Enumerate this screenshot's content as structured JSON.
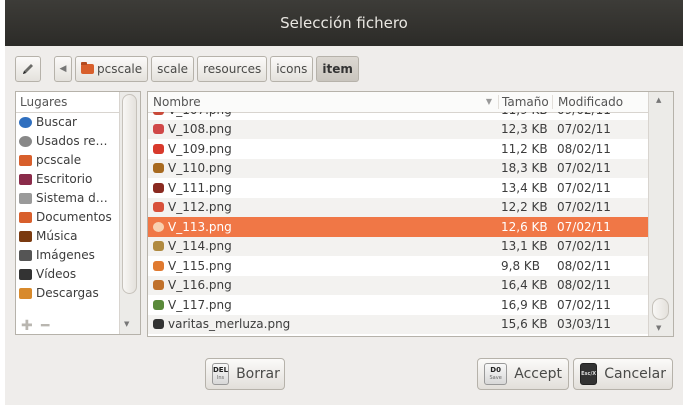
{
  "window": {
    "title": "Selección fichero"
  },
  "pathbar": {
    "items": [
      {
        "label": "pcscale"
      },
      {
        "label": "scale"
      },
      {
        "label": "resources"
      },
      {
        "label": "icons"
      },
      {
        "label": "item"
      }
    ]
  },
  "places": {
    "header": "Lugares",
    "items": [
      {
        "label": "Buscar",
        "icon": "search-icon",
        "color": "#2f6fbf"
      },
      {
        "label": "Usados re…",
        "icon": "clock-icon",
        "color": "#888888"
      },
      {
        "label": "pcscale",
        "icon": "home-folder-icon",
        "color": "#d85f2c"
      },
      {
        "label": "Escritorio",
        "icon": "desktop-icon",
        "color": "#8a2b4a"
      },
      {
        "label": "Sistema d…",
        "icon": "drive-icon",
        "color": "#9a9a9a"
      },
      {
        "label": "Documentos",
        "icon": "documents-icon",
        "color": "#d85f2c"
      },
      {
        "label": "Música",
        "icon": "music-icon",
        "color": "#7a3a10"
      },
      {
        "label": "Imágenes",
        "icon": "pictures-icon",
        "color": "#555555"
      },
      {
        "label": "Vídeos",
        "icon": "videos-icon",
        "color": "#333333"
      },
      {
        "label": "Descargas",
        "icon": "downloads-icon",
        "color": "#d88a2c"
      }
    ]
  },
  "files": {
    "columns": {
      "name": "Nombre",
      "size": "Tamaño",
      "modified": "Modificado"
    },
    "rows": [
      {
        "name": "V_107.png",
        "size": "11,9 KB",
        "modified": "09/02/11",
        "color": "#c94a3a"
      },
      {
        "name": "V_108.png",
        "size": "12,3 KB",
        "modified": "07/02/11",
        "color": "#d04848"
      },
      {
        "name": "V_109.png",
        "size": "11,2 KB",
        "modified": "08/02/11",
        "color": "#d83a2c"
      },
      {
        "name": "V_110.png",
        "size": "18,3 KB",
        "modified": "07/02/11",
        "color": "#a86a20"
      },
      {
        "name": "V_111.png",
        "size": "13,4 KB",
        "modified": "07/02/11",
        "color": "#8a2a20"
      },
      {
        "name": "V_112.png",
        "size": "12,2 KB",
        "modified": "07/02/11",
        "color": "#d8503a"
      },
      {
        "name": "V_113.png",
        "size": "12,6 KB",
        "modified": "07/02/11",
        "color": "#f8d0b0",
        "selected": true
      },
      {
        "name": "V_114.png",
        "size": "13,1 KB",
        "modified": "07/02/11",
        "color": "#b08a40"
      },
      {
        "name": "V_115.png",
        "size": "9,8 KB",
        "modified": "08/02/11",
        "color": "#e07a30"
      },
      {
        "name": "V_116.png",
        "size": "16,4 KB",
        "modified": "08/02/11",
        "color": "#c0702a"
      },
      {
        "name": "V_117.png",
        "size": "16,9 KB",
        "modified": "07/02/11",
        "color": "#5a8a3a"
      },
      {
        "name": "varitas_merluza.png",
        "size": "15,6 KB",
        "modified": "03/03/11",
        "color": "#333333"
      }
    ]
  },
  "buttons": {
    "delete": {
      "label": "Borrar",
      "key": "DEL",
      "key_sub": "Ins"
    },
    "accept": {
      "label": "Accept",
      "key": "D0",
      "key_sub": "Save"
    },
    "cancel": {
      "label": "Cancelar",
      "key": "Esc/X"
    }
  }
}
